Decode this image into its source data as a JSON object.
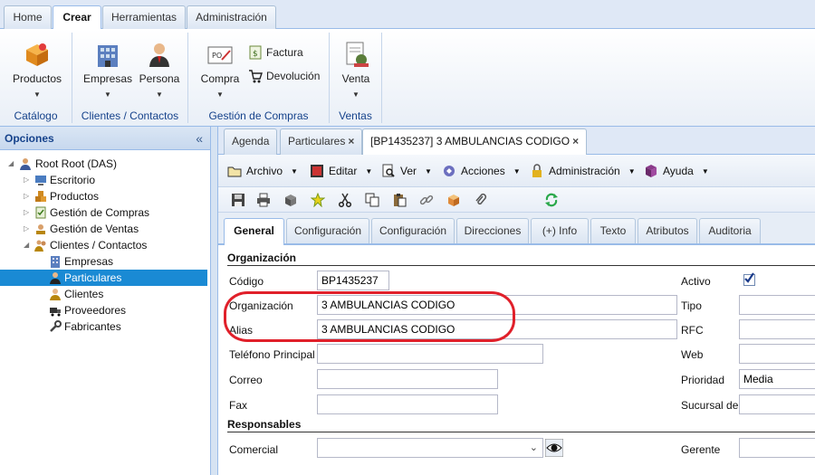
{
  "ribbon": {
    "tabs": [
      "Home",
      "Crear",
      "Herramientas",
      "Administración"
    ],
    "groups": [
      {
        "label": "Catálogo",
        "buttons": [
          "Productos"
        ]
      },
      {
        "label": "Clientes / Contactos",
        "buttons": [
          "Empresas",
          "Persona"
        ]
      },
      {
        "label": "Gestión de Compras",
        "buttons": [
          "Compra"
        ],
        "small": [
          "Factura",
          "Devolución"
        ]
      },
      {
        "label": "Ventas",
        "buttons": [
          "Venta"
        ]
      }
    ]
  },
  "sidebar": {
    "title": "Opciones",
    "tree": [
      {
        "label": "Root Root (DAS)"
      },
      {
        "label": "Escritorio"
      },
      {
        "label": "Productos"
      },
      {
        "label": "Gestión de Compras"
      },
      {
        "label": "Gestión de Ventas"
      },
      {
        "label": "Clientes / Contactos"
      },
      {
        "label": "Empresas"
      },
      {
        "label": "Particulares"
      },
      {
        "label": "Clientes"
      },
      {
        "label": "Proveedores"
      },
      {
        "label": "Fabricantes"
      }
    ]
  },
  "doc_tabs": [
    "Agenda",
    "Particulares",
    "[BP1435237] 3 AMBULANCIAS CODIGO"
  ],
  "menu": [
    "Archivo",
    "Editar",
    "Ver",
    "Acciones",
    "Administración",
    "Ayuda"
  ],
  "form_tabs": [
    "General",
    "Configuración",
    "Configuración",
    "Direcciones",
    "(+) Info",
    "Texto",
    "Atributos",
    "Auditoria"
  ],
  "form": {
    "section_org": "Organización",
    "section_resp": "Responsables",
    "codigo_label": "Código",
    "codigo_value": "BP1435237",
    "organizacion_label": "Organización",
    "organizacion_value": "3 AMBULANCIAS CODIGO",
    "alias_label": "Alias",
    "alias_value": "3 AMBULANCIAS CODIGO",
    "telefono_label": "Teléfono Principal",
    "correo_label": "Correo",
    "fax_label": "Fax",
    "comercial_label": "Comercial",
    "activo_label": "Activo",
    "activo_checked": true,
    "tipo_label": "Tipo",
    "rfc_label": "RFC",
    "web_label": "Web",
    "prioridad_label": "Prioridad",
    "prioridad_value": "Media",
    "sucursal_label": "Sucursal de",
    "gerente_label": "Gerente"
  },
  "colors": {
    "accent": "#1a8ad4",
    "highlight": "#e0202a",
    "header": "#15428b"
  }
}
